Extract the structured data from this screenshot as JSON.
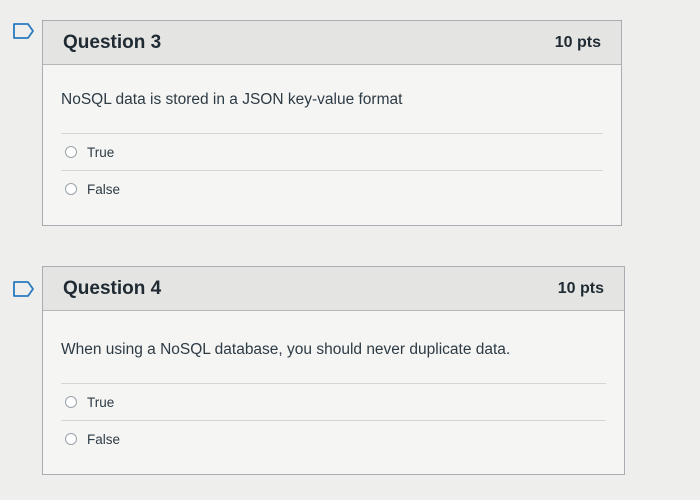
{
  "questions": [
    {
      "title": "Question 3",
      "points": "10 pts",
      "prompt": "NoSQL data is stored in a JSON key-value format",
      "answers": [
        "True",
        "False"
      ]
    },
    {
      "title": "Question 4",
      "points": "10 pts",
      "prompt": "When using a NoSQL database, you should never duplicate data.",
      "answers": [
        "True",
        "False"
      ]
    }
  ],
  "colors": {
    "background": "#eeeeec",
    "card": "#f5f5f3",
    "header": "#e4e4e2",
    "border": "#a8adb2",
    "text": "#2d3b45"
  },
  "icons": {
    "flag": "bookmark-flag-icon"
  }
}
